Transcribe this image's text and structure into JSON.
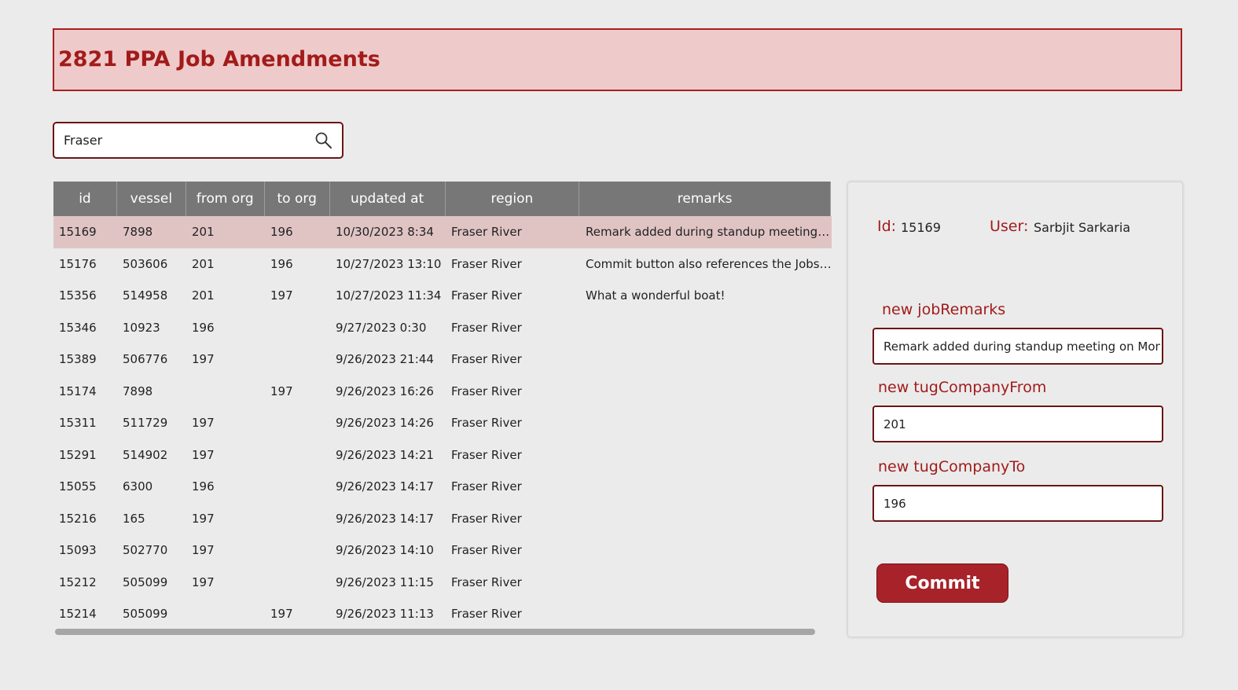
{
  "header": {
    "title": "2821 PPA Job Amendments"
  },
  "search": {
    "value": "Fraser"
  },
  "table": {
    "columns": [
      "id",
      "vessel",
      "from org",
      "to org",
      "updated at",
      "region",
      "remarks"
    ],
    "rows": [
      [
        "15169",
        "7898",
        "201",
        "196",
        "10/30/2023 8:34",
        "Fraser River",
        "Remark added during standup meeting on ."
      ],
      [
        "15176",
        "503606",
        "201",
        "196",
        "10/27/2023 13:10",
        "Fraser River",
        "Commit button also references the Jobs ta..."
      ],
      [
        "15356",
        "514958",
        "201",
        "197",
        "10/27/2023 11:34",
        "Fraser River",
        "What a wonderful boat!"
      ],
      [
        "15346",
        "10923",
        "196",
        "",
        "9/27/2023 0:30",
        "Fraser River",
        ""
      ],
      [
        "15389",
        "506776",
        "197",
        "",
        "9/26/2023 21:44",
        "Fraser River",
        ""
      ],
      [
        "15174",
        "7898",
        "",
        "197",
        "9/26/2023 16:26",
        "Fraser River",
        ""
      ],
      [
        "15311",
        "511729",
        "197",
        "",
        "9/26/2023 14:26",
        "Fraser River",
        ""
      ],
      [
        "15291",
        "514902",
        "197",
        "",
        "9/26/2023 14:21",
        "Fraser River",
        ""
      ],
      [
        "15055",
        "6300",
        "196",
        "",
        "9/26/2023 14:17",
        "Fraser River",
        ""
      ],
      [
        "15216",
        "165",
        "197",
        "",
        "9/26/2023 14:17",
        "Fraser River",
        ""
      ],
      [
        "15093",
        "502770",
        "197",
        "",
        "9/26/2023 14:10",
        "Fraser River",
        ""
      ],
      [
        "15212",
        "505099",
        "197",
        "",
        "9/26/2023 11:15",
        "Fraser River",
        ""
      ],
      [
        "15214",
        "505099",
        "",
        "197",
        "9/26/2023 11:13",
        "Fraser River",
        ""
      ]
    ]
  },
  "detail": {
    "id_label": "Id:",
    "id_value": "15169",
    "user_label": "User:",
    "user_value": "Sarbjit Sarkaria",
    "remarks_label": "new jobRemarks",
    "remarks_value": "Remark added during standup meeting on Monday",
    "from_label": "new tugCompanyFrom",
    "from_value": "201",
    "to_label": "new tugCompanyTo",
    "to_value": "196",
    "commit_label": "Commit"
  },
  "colors": {
    "accent": "#a21b1b",
    "header_bg": "#efcaca",
    "table_header_bg": "#777777",
    "selected_row_bg": "#e0c4c4",
    "commit_bg": "#a8222a"
  },
  "icons": {
    "search": "search-icon"
  }
}
